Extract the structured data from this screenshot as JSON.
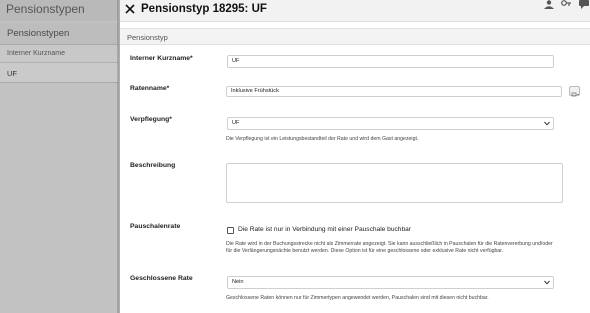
{
  "backdrop": {
    "title": "Pensionstypen",
    "panel_header": "Pensionstypen",
    "column_header": "Interner Kurzname",
    "row_value": "UF"
  },
  "modal": {
    "title": "Pensionstyp 18295: UF",
    "section_title": "Pensionstyp",
    "header_icons": [
      "person-icon",
      "key-icon",
      "chat-icon"
    ]
  },
  "form": {
    "kurzname": {
      "label": "Interner Kurzname*",
      "value": "UF"
    },
    "ratenname": {
      "label": "Ratenname*",
      "value": "Inklusive Frühstück"
    },
    "verpflegung": {
      "label": "Verpflegung*",
      "value": "UF",
      "help": "Die Verpflegung ist ein Leistungsbestandteil der Rate und wird dem Gast angezeigt."
    },
    "beschreibung": {
      "label": "Beschreibung",
      "value": ""
    },
    "pauschalenrate": {
      "label": "Pauschalenrate",
      "checkbox_label": "Die Rate ist nur in Verbindung mit einer Pauschale buchbar",
      "checked": false,
      "help_line1": "Die Rate wird in der Buchungsstrecke nicht als Zimmerrate angezeigt. Sie kann ausschließlich in Pauschalen für die Ratenvererbung und/oder",
      "help_line2": "für die Verlängerungsnächte benutzt werden. Diese Option ist für eine geschlossene oder exklusive Rate nicht verfügbar."
    },
    "geschlossene_rate": {
      "label": "Geschlossene Rate",
      "value": "Nein",
      "help": "Geschlossene Raten können nur für Zimmertypen angewendet werden, Pauschalen sind mit diesen nicht buchbar."
    }
  },
  "colors": {
    "modal_bg": "#ffffff",
    "header_bg": "#f2f2f2",
    "backdrop": "#b9b9b9",
    "border": "#cfcfcf"
  }
}
